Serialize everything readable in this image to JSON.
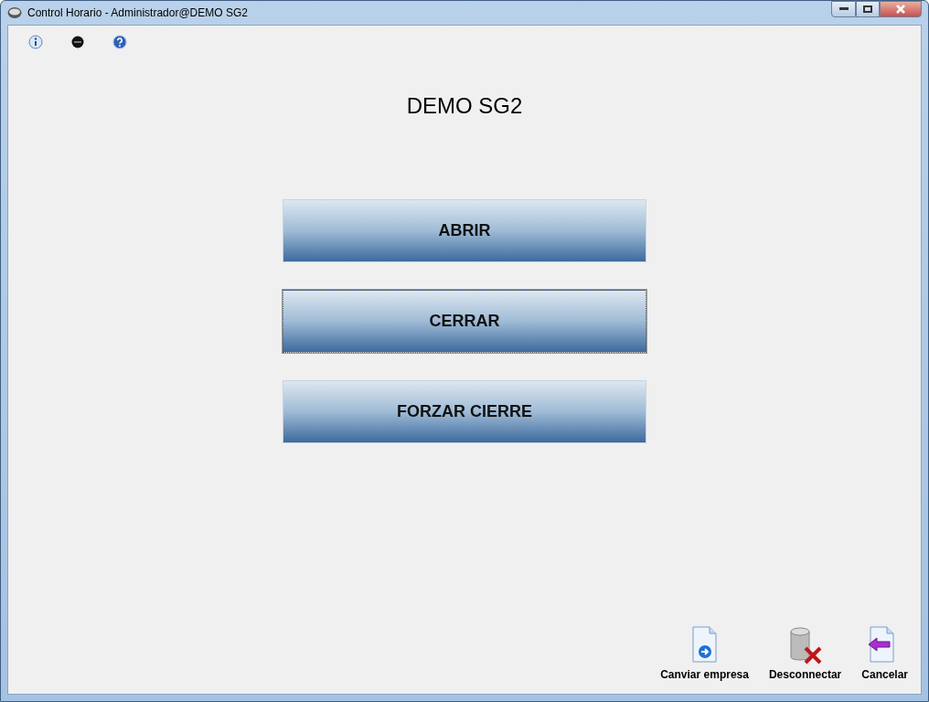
{
  "window": {
    "title": "Control Horario - Administrador@DEMO SG2"
  },
  "toolbar": [
    {
      "kind": "info"
    },
    {
      "kind": "stop"
    },
    {
      "kind": "help"
    }
  ],
  "heading": "DEMO SG2",
  "actions": [
    {
      "label": "ABRIR",
      "focused": false
    },
    {
      "label": "CERRAR",
      "focused": true
    },
    {
      "label": "FORZAR CIERRE",
      "focused": false
    }
  ],
  "footer_buttons": [
    {
      "kind": "switch",
      "label": "Canviar empresa"
    },
    {
      "kind": "disconnect",
      "label": "Desconnectar"
    },
    {
      "kind": "cancel",
      "label": "Cancelar"
    }
  ]
}
